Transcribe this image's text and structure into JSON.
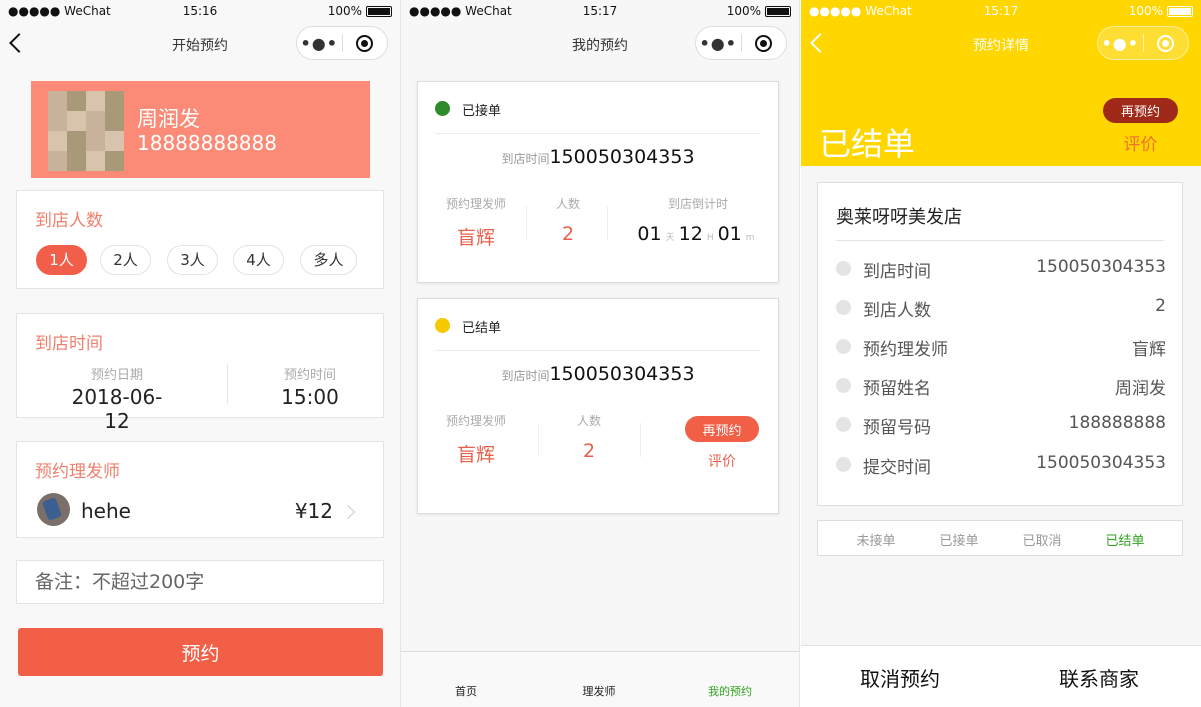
{
  "status_bar": {
    "carrier": "●●●●● WeChat",
    "battery": "100%"
  },
  "screen1": {
    "time": "15:16",
    "title": "开始预约",
    "profile": {
      "name": "周润发",
      "phone": "18888888888"
    },
    "people": {
      "title": "到店人数",
      "options": [
        "1人",
        "2人",
        "3人",
        "4人",
        "多人"
      ],
      "selected": "1人"
    },
    "arrival": {
      "title": "到店时间",
      "date_label": "预约日期",
      "date_value": "2018-06-12",
      "time_label": "预约时间",
      "time_value": "15:00"
    },
    "stylist": {
      "title": "预约理发师",
      "name": "hehe",
      "price": "¥12"
    },
    "note_placeholder": "备注：不超过200字",
    "submit_label": "预约"
  },
  "screen2": {
    "time": "15:17",
    "title": "我的预约",
    "orders": [
      {
        "status": "已接单",
        "status_color": "#2e8b2a",
        "arrival_label": "到店时间",
        "arrival_value": "150050304353",
        "stylist_label": "预约理发师",
        "stylist_value": "盲辉",
        "people_label": "人数",
        "people_value": "2",
        "countdown_label": "到店倒计时",
        "countdown": {
          "days": "01",
          "days_unit": "天",
          "hours": "12",
          "hours_unit": "H",
          "minutes": "01",
          "minutes_unit": "m"
        }
      },
      {
        "status": "已结单",
        "status_color": "#f5c800",
        "arrival_label": "到店时间",
        "arrival_value": "150050304353",
        "stylist_label": "预约理发师",
        "stylist_value": "盲辉",
        "people_label": "人数",
        "people_value": "2",
        "rebook_label": "再预约",
        "review_label": "评价"
      }
    ],
    "tabs": [
      "首页",
      "理发师",
      "我的预约"
    ],
    "active_tab": "我的预约"
  },
  "screen3": {
    "time": "15:17",
    "title": "预约详情",
    "status_title": "已结单",
    "rebook_label": "再预约",
    "review_label": "评价",
    "shop_name": "奥莱呀呀美发店",
    "details": [
      {
        "key": "到店时间",
        "value": "150050304353"
      },
      {
        "key": "到店人数",
        "value": "2"
      },
      {
        "key": "预约理发师",
        "value": "盲辉"
      },
      {
        "key": "预留姓名",
        "value": "周润发"
      },
      {
        "key": "预留号码",
        "value": "188888888"
      },
      {
        "key": "提交时间",
        "value": "150050304353"
      }
    ],
    "steps": [
      "未接单",
      "已接单",
      "已取消",
      "已结单"
    ],
    "current_step": "已结单",
    "cancel_label": "取消预约",
    "contact_label": "联系商家"
  },
  "colors": {
    "accent": "#f25f47",
    "header_yellow": "#ffd600",
    "success_green": "#31a31f"
  }
}
